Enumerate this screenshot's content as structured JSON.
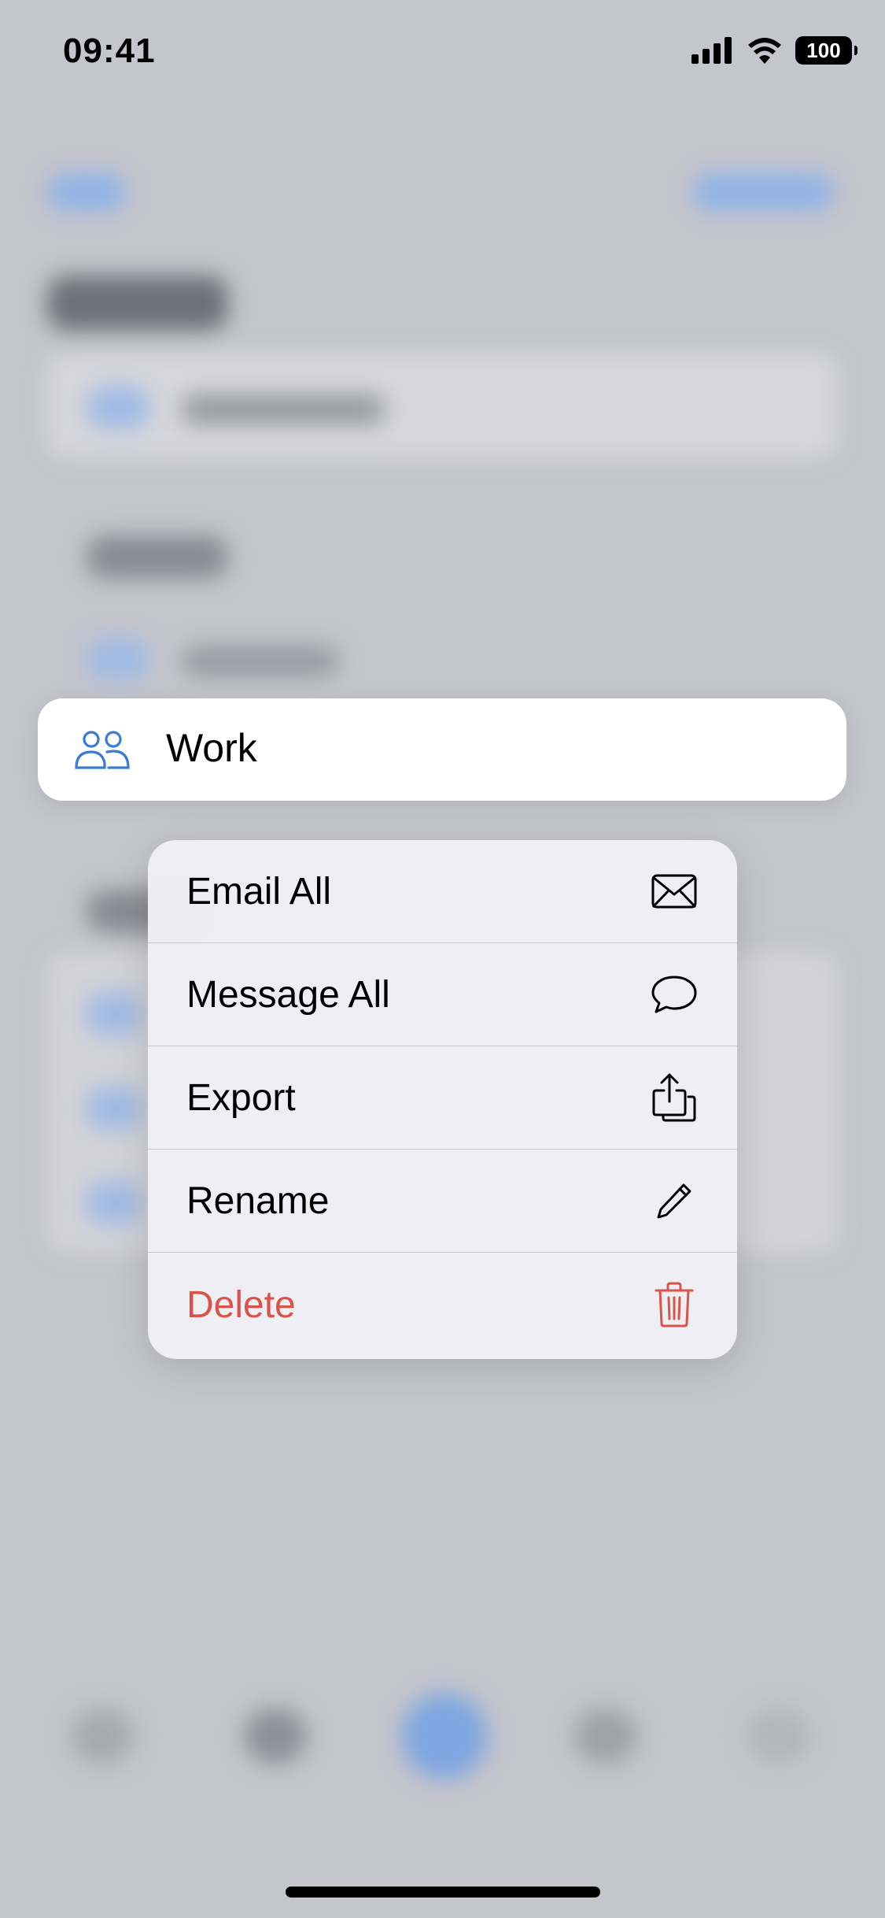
{
  "status_bar": {
    "time": "09:41",
    "battery": "100",
    "icons": [
      "cellular-signal-icon",
      "wifi-icon",
      "battery-icon"
    ]
  },
  "preview_card": {
    "title": "Work",
    "icon": "two-people-icon"
  },
  "context_menu": {
    "items": [
      {
        "label": "Email All",
        "icon": "envelope-icon"
      },
      {
        "label": "Message All",
        "icon": "speech-bubble-icon"
      },
      {
        "label": "Export",
        "icon": "share-icon"
      },
      {
        "label": "Rename",
        "icon": "pencil-icon"
      },
      {
        "label": "Delete",
        "icon": "trash-icon",
        "destructive": true
      }
    ]
  },
  "colors": {
    "accent": "#3a7bd5",
    "destructive": "#d9534a",
    "backdrop": "#c5c5cd"
  }
}
